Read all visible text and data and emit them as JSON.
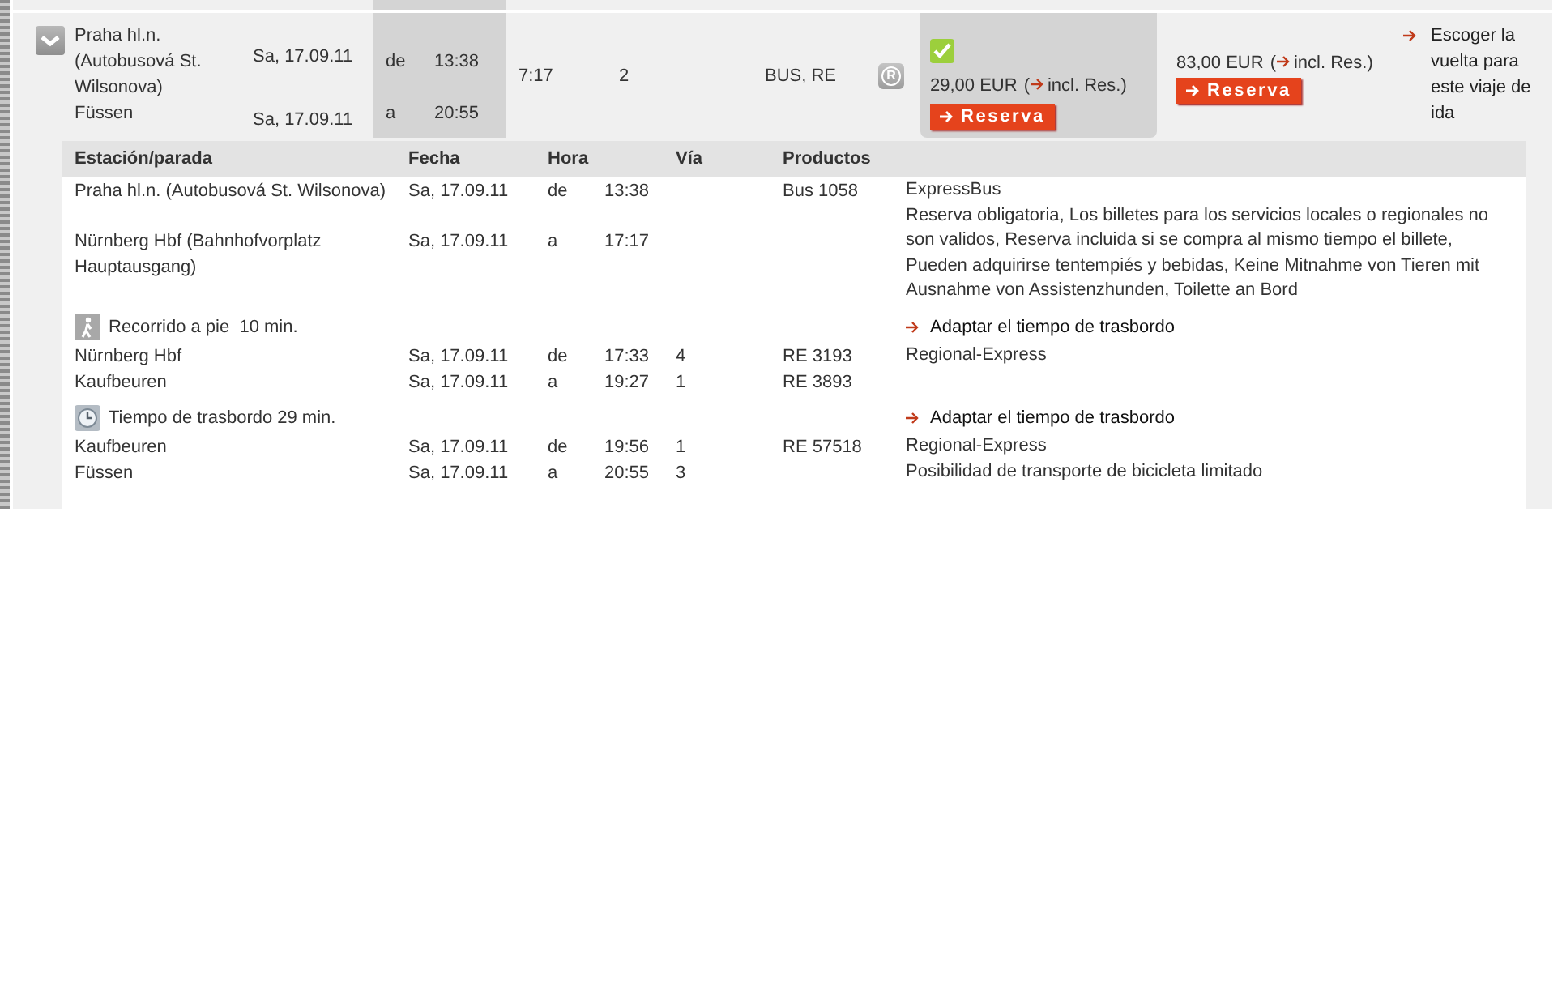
{
  "journey": {
    "expanded": true,
    "stops": [
      {
        "station": "Praha hl.n. (Autobusová St. Wilsonova)",
        "date": "Sa, 17.09.11",
        "dir": "de",
        "time": "13:38"
      },
      {
        "station": "Füssen",
        "date": "Sa, 17.09.11",
        "dir": "a",
        "time": "20:55"
      }
    ],
    "duration": "7:17",
    "changes": "2",
    "products": "BUS, RE",
    "reservation_mark": "R",
    "fares": [
      {
        "selected": true,
        "amount": "29,00 EUR",
        "link_open": "(",
        "link": "incl. Res.)",
        "button": "Reserva"
      },
      {
        "selected": false,
        "amount": "83,00 EUR",
        "link_open": "(",
        "link": "incl. Res.)",
        "button": "Reserva"
      }
    ],
    "return_link": "Escoger la vuelta para este viaje de ida"
  },
  "details": {
    "columns": [
      "Estación/parada",
      "Fecha",
      "Hora",
      "Vía",
      "Productos"
    ],
    "sections": [
      {
        "kind": "leg",
        "stops": [
          {
            "station": "Praha hl.n. (Autobusová St. Wilsonova)",
            "date": "Sa, 17.09.11",
            "dir": "de",
            "time": "13:38",
            "product": "Bus 1058"
          },
          {
            "station": "Nürnberg Hbf (Bahnhofvorplatz Hauptausgang)",
            "date": "Sa, 17.09.11",
            "dir": "a",
            "time": "17:17"
          }
        ],
        "notes": [
          "ExpressBus",
          "Reserva obligatoria, Los billetes para los servicios locales o regionales no son validos, Reserva incluida si se compra al mismo tiempo el billete, Pueden adquirirse tentempiés y bebidas, Keine Mitnahme von Tieren mit Ausnahme von Assistenzhunden, Toilette an Bord"
        ]
      },
      {
        "kind": "walk",
        "text": "Recorrido a pie  10 min.",
        "link": "Adaptar el tiempo de trasbordo"
      },
      {
        "kind": "leg",
        "stops": [
          {
            "station": "Nürnberg Hbf",
            "date": "Sa, 17.09.11",
            "dir": "de",
            "time": "17:33",
            "track": "4",
            "product": "RE 3193"
          },
          {
            "station": "Kaufbeuren",
            "date": "Sa, 17.09.11",
            "dir": "a",
            "time": "19:27",
            "track": "1",
            "product": "RE 3893"
          }
        ],
        "notes": [
          "Regional-Express"
        ]
      },
      {
        "kind": "transfer",
        "text": "Tiempo de trasbordo 29 min.",
        "link": "Adaptar el tiempo de trasbordo"
      },
      {
        "kind": "leg",
        "stops": [
          {
            "station": "Kaufbeuren",
            "date": "Sa, 17.09.11",
            "dir": "de",
            "time": "19:56",
            "track": "1",
            "product": "RE 57518"
          },
          {
            "station": "Füssen",
            "date": "Sa, 17.09.11",
            "dir": "a",
            "time": "20:55",
            "track": "3"
          }
        ],
        "notes": [
          "Regional-Express",
          "Posibilidad de transporte de bicicleta limitado"
        ]
      }
    ]
  }
}
